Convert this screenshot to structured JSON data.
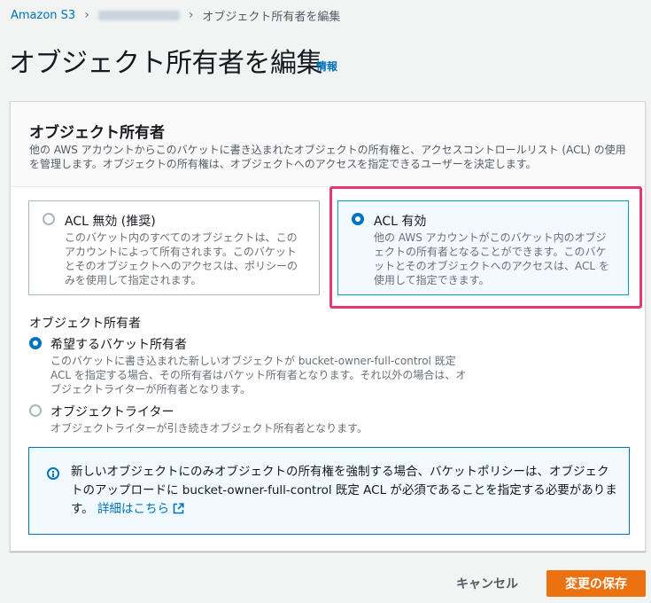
{
  "breadcrumb": {
    "root": "Amazon S3",
    "current": "オブジェクト所有者を編集"
  },
  "header": {
    "title": "オブジェクト所有者を編集",
    "info": "情報"
  },
  "section": {
    "title": "オブジェクト所有者",
    "description": "他の AWS アカウントからこのバケットに書き込まれたオブジェクトの所有権と、アクセスコントロールリスト (ACL) の使用を管理します。オブジェクトの所有権は、オブジェクトへのアクセスを指定できるユーザーを決定します。"
  },
  "tiles": [
    {
      "label": "ACL 無効 (推奨)",
      "description": "このバケット内のすべてのオブジェクトは、このアカウントによって所有されます。このバケットとそのオブジェクトへのアクセスは、ポリシーのみを使用して指定されます。",
      "selected": false
    },
    {
      "label": "ACL 有効",
      "description": "他の AWS アカウントがこのバケット内のオブジェクトの所有者となることができます。このバケットとそのオブジェクトへのアクセスは、ACL を使用して指定できます。",
      "selected": true
    }
  ],
  "owner": {
    "label": "オブジェクト所有者",
    "options": [
      {
        "label": "希望するバケット所有者",
        "description": "このバケットに書き込まれた新しいオブジェクトが bucket-owner-full-control 既定 ACL を指定する場合、その所有者はバケット所有者となります。それ以外の場合は、オブジェクトライターが所有者となります。",
        "selected": true
      },
      {
        "label": "オブジェクトライター",
        "description": "オブジェクトライターが引き続きオブジェクト所有者となります。",
        "selected": false
      }
    ]
  },
  "alert": {
    "text": "新しいオブジェクトにのみオブジェクトの所有権を強制する場合、バケットポリシーは、オブジェクトのアップロードに bucket-owner-full-control 既定 ACL が必須であることを指定する必要があります。",
    "link": "詳細はこちら"
  },
  "actions": {
    "cancel": "キャンセル",
    "save": "変更の保存"
  },
  "colors": {
    "link": "#0073bb",
    "primary_button": "#ec7211",
    "highlight": "#e8366f",
    "selected_border": "#00a1c9"
  }
}
